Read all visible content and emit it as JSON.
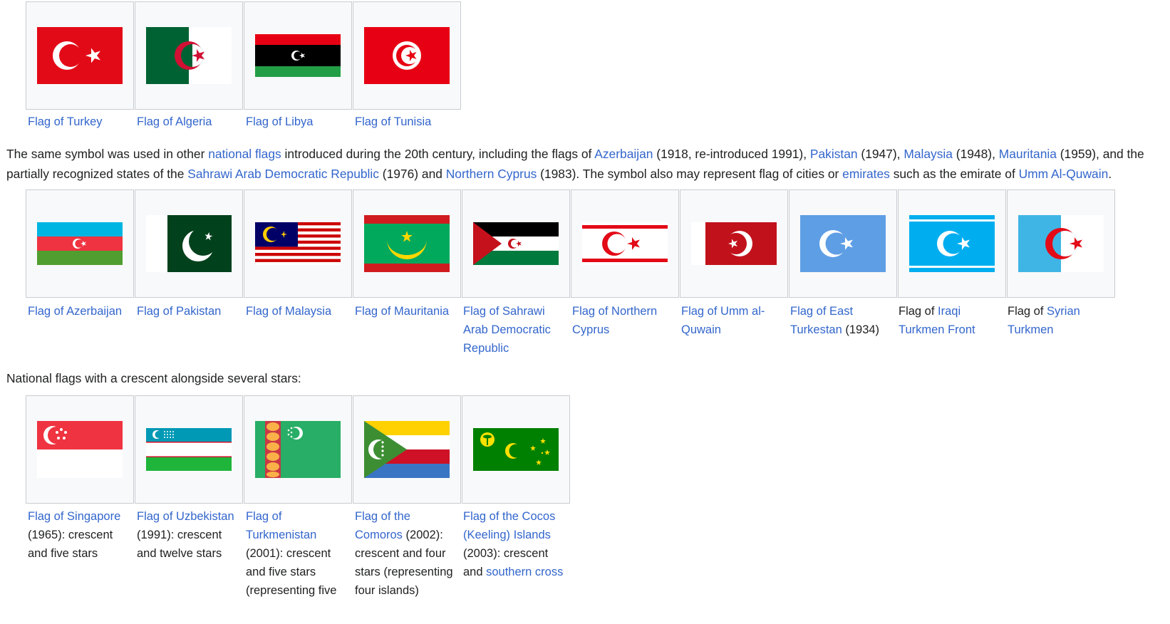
{
  "gallery1": [
    {
      "link": "Flag of Turkey",
      "after": ""
    },
    {
      "link": "Flag of Algeria",
      "after": ""
    },
    {
      "link": "Flag of Libya",
      "after": ""
    },
    {
      "link": "Flag of Tunisia",
      "after": ""
    }
  ],
  "para1": [
    {
      "t": "The same symbol was used in other "
    },
    {
      "t": "national flags",
      "link": true
    },
    {
      "t": " introduced during the 20th century, including the flags of "
    },
    {
      "t": "Azerbaijan",
      "link": true
    },
    {
      "t": " (1918, re-introduced 1991), "
    },
    {
      "t": "Pakistan",
      "link": true
    },
    {
      "t": " (1947), "
    },
    {
      "t": "Malaysia",
      "link": true
    },
    {
      "t": " (1948), "
    },
    {
      "t": "Mauritania",
      "link": true
    },
    {
      "t": " (1959), and the partially recognized states of the "
    },
    {
      "t": "Sahrawi Arab Democratic Republic",
      "link": true
    },
    {
      "t": " (1976) and "
    },
    {
      "t": "Northern Cyprus",
      "link": true
    },
    {
      "t": " (1983). The symbol also may represent flag of cities or "
    },
    {
      "t": "emirates",
      "link": true
    },
    {
      "t": " such as the emirate of "
    },
    {
      "t": "Umm Al-Quwain",
      "link": true
    },
    {
      "t": "."
    }
  ],
  "gallery2": [
    {
      "pre": "",
      "link": "Flag of Azerbaijan",
      "after": ""
    },
    {
      "pre": "",
      "link": "Flag of Pakistan",
      "after": ""
    },
    {
      "pre": "",
      "link": "Flag of Malaysia",
      "after": ""
    },
    {
      "pre": "",
      "link": "Flag of Mauritania",
      "after": ""
    },
    {
      "pre": "",
      "link": "Flag of Sahrawi Arab Democratic Republic",
      "after": ""
    },
    {
      "pre": "",
      "link": "Flag of Northern Cyprus",
      "after": ""
    },
    {
      "pre": "",
      "link": "Flag of Umm al-Quwain",
      "after": ""
    },
    {
      "pre": "",
      "link": "Flag of East Turkestan",
      "after": " (1934)"
    },
    {
      "pre": "Flag of ",
      "link": "Iraqi Turkmen Front",
      "after": ""
    },
    {
      "pre": "Flag of ",
      "link": "Syrian Turkmen",
      "after": ""
    }
  ],
  "para2": "National flags with a crescent alongside several stars:",
  "gallery3": [
    {
      "link": "Flag of Singapore",
      "after": " (1965): crescent and five stars",
      "link2": "",
      "after2": ""
    },
    {
      "link": "Flag of Uzbekistan",
      "after": " (1991): crescent and twelve stars",
      "link2": "",
      "after2": ""
    },
    {
      "link": "Flag of Turkmenistan",
      "after": " (2001): crescent and five stars (representing five",
      "link2": "",
      "after2": ""
    },
    {
      "link": "Flag of the Comoros",
      "after": " (2002): crescent and four stars (representing four islands)",
      "link2": "",
      "after2": ""
    },
    {
      "link": "Flag of the Cocos (Keeling) Islands",
      "after": " (2003): crescent and ",
      "link2": "southern cross",
      "after2": ""
    }
  ],
  "colors": {
    "link": "#3366cc",
    "text": "#202122",
    "box_bg": "#f8f9fa",
    "box_border": "#c8ccd1"
  }
}
